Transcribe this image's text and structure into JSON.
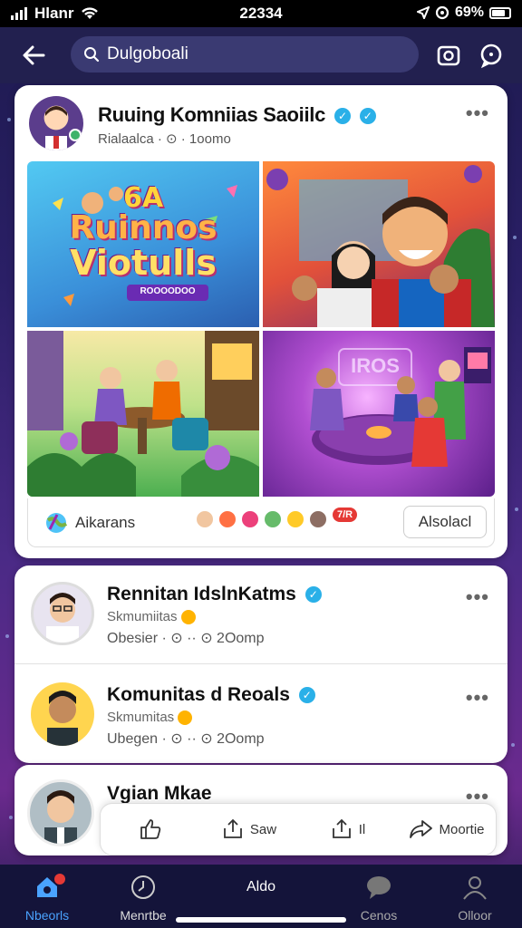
{
  "status_bar": {
    "carrier": "Hlanr",
    "time": "22334",
    "battery": "69%"
  },
  "header": {
    "search_text": "Dulgoboali"
  },
  "post": {
    "title": "Ruuing Komniias Saoiilc",
    "subtitle": "Rialaalca · ⊙ · 1oomo",
    "images": [
      {
        "text_line1": "6A",
        "text_line2": "Ruinnos",
        "text_line3": "Viotulls",
        "tag": "ROOOODOO"
      },
      {
        "text": ""
      },
      {
        "text": ""
      },
      {
        "text": "IROS"
      }
    ],
    "footer_label": "Aikarans",
    "footer_badge": "7/R",
    "footer_button": "Alsolacl"
  },
  "list": [
    {
      "title": "Rennitan IdslnKatms",
      "sub": "Skmumiitas",
      "meta": "Obesier · ⊙ ·· ⊙ 2Oomp"
    },
    {
      "title": "Komunitas d Reoals",
      "sub": "Skmumitas",
      "meta": "Ubegen · ⊙ ·· ⊙ 2Oomp"
    }
  ],
  "last_item": {
    "title": "Vgian Mkae"
  },
  "action_bar": {
    "save": "Saw",
    "share": "Il",
    "more": "Moortie"
  },
  "bottom_nav": [
    {
      "label": "Nbeorls",
      "active": true
    },
    {
      "label": "Menrtbe",
      "active": false
    },
    {
      "label": "Aldo",
      "active": false
    },
    {
      "label": "Cenos",
      "active": false
    },
    {
      "label": "Olloor",
      "active": false
    }
  ],
  "colors": {
    "accent": "#4aa3ff",
    "verified": "#2ab0e8",
    "background_top": "#1d1a4e",
    "background_mid": "#6b2a8e"
  }
}
